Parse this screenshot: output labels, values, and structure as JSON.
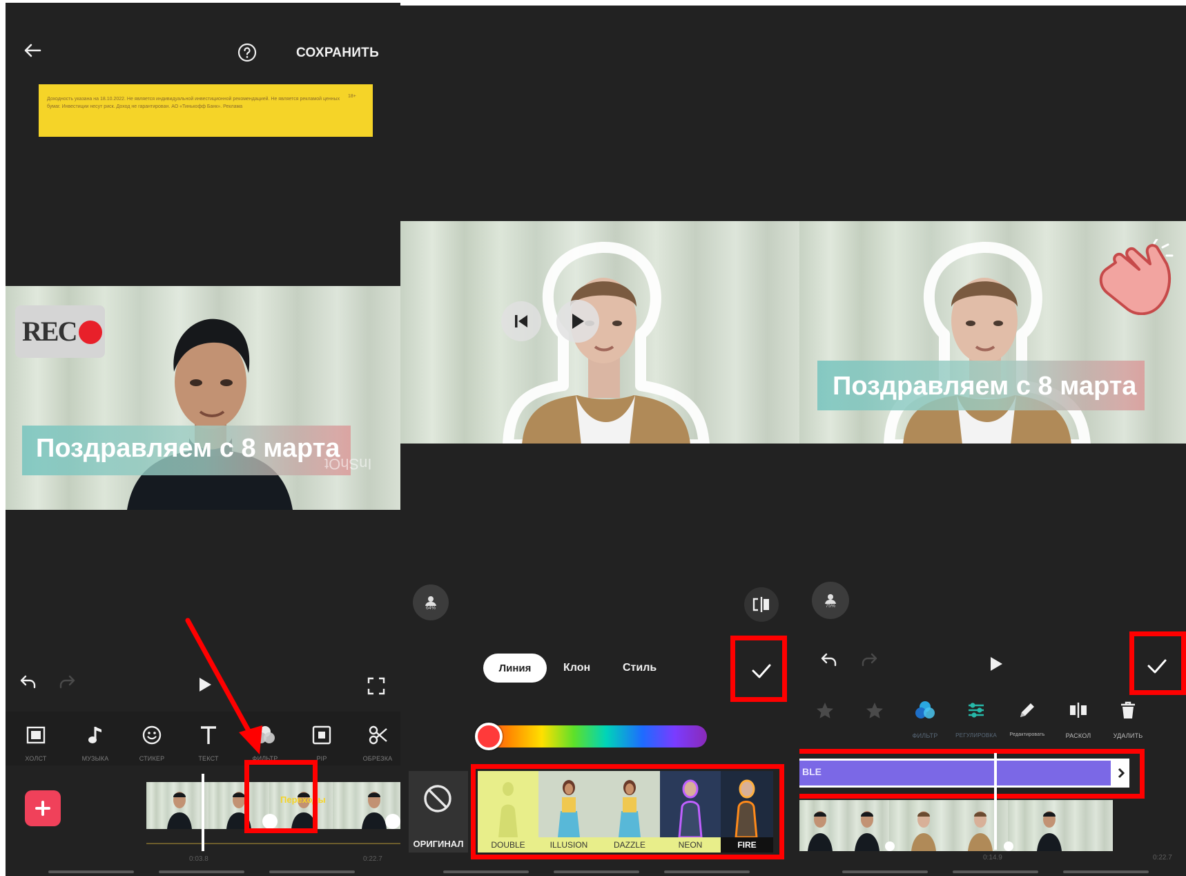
{
  "panel1": {
    "save_label": "СОХРАНИТЬ",
    "ad_text": "Доходность указана на 18.10.2022. Не является индивидуальной инвестиционной рекомендацией. Не является рекламой ценных бумаг. Инвестиции несут риск. Доход не гарантирован. АО «Тинькофф Банк». Реклама",
    "ad_age": "18+",
    "rec_label": "REC",
    "caption": "Поздравляем с 8 марта",
    "watermark": "InShOt",
    "tools": [
      {
        "label": "ХОЛСТ",
        "icon": "canvas-icon"
      },
      {
        "label": "МУЗЫКА",
        "icon": "music-icon"
      },
      {
        "label": "СТИКЕР",
        "icon": "sticker-icon"
      },
      {
        "label": "ТЕКСТ",
        "icon": "text-icon"
      },
      {
        "label": "ФИЛЬТР",
        "icon": "filter-icon"
      },
      {
        "label": "PIP",
        "icon": "pip-icon"
      },
      {
        "label": "ОБРЕЗКА",
        "icon": "scissors-icon"
      }
    ],
    "transition_label": "Переходы",
    "time_current": "0:03.8",
    "time_total": "0:22.7",
    "accent_red": "#ff0000",
    "add_button_color": "#f0415a",
    "ad_color": "#f5d428"
  },
  "panel2": {
    "tabs": [
      "Линия",
      "Клон",
      "Стиль"
    ],
    "active_tab": "Линия",
    "opacity_badge": "64%",
    "original_label": "ОРИГИНАЛ",
    "styles": [
      "DOUBLE",
      "ILLUSION",
      "DAZZLE",
      "NEON",
      "FIRE"
    ],
    "selected_style": "FIRE"
  },
  "panel3": {
    "caption": "Поздравляем с 8 марта",
    "opacity_badge": "75%",
    "tools": [
      {
        "label": "",
        "icon": "star-icon"
      },
      {
        "label": "",
        "icon": "star-plus-icon"
      },
      {
        "label": "ФИЛЬТР",
        "icon": "filter-icon"
      },
      {
        "label": "РЕГУЛИРОВКА",
        "icon": "adjust-icon"
      },
      {
        "label": "Редактировать",
        "icon": "pencil-icon"
      },
      {
        "label": "РАСКОЛ",
        "icon": "split-icon"
      },
      {
        "label": "УДАЛИТЬ",
        "icon": "trash-icon"
      }
    ],
    "track_label": "BLE",
    "time_current": "0:14.9",
    "time_total": "0:22.7",
    "track_color": "#7b68e6"
  }
}
